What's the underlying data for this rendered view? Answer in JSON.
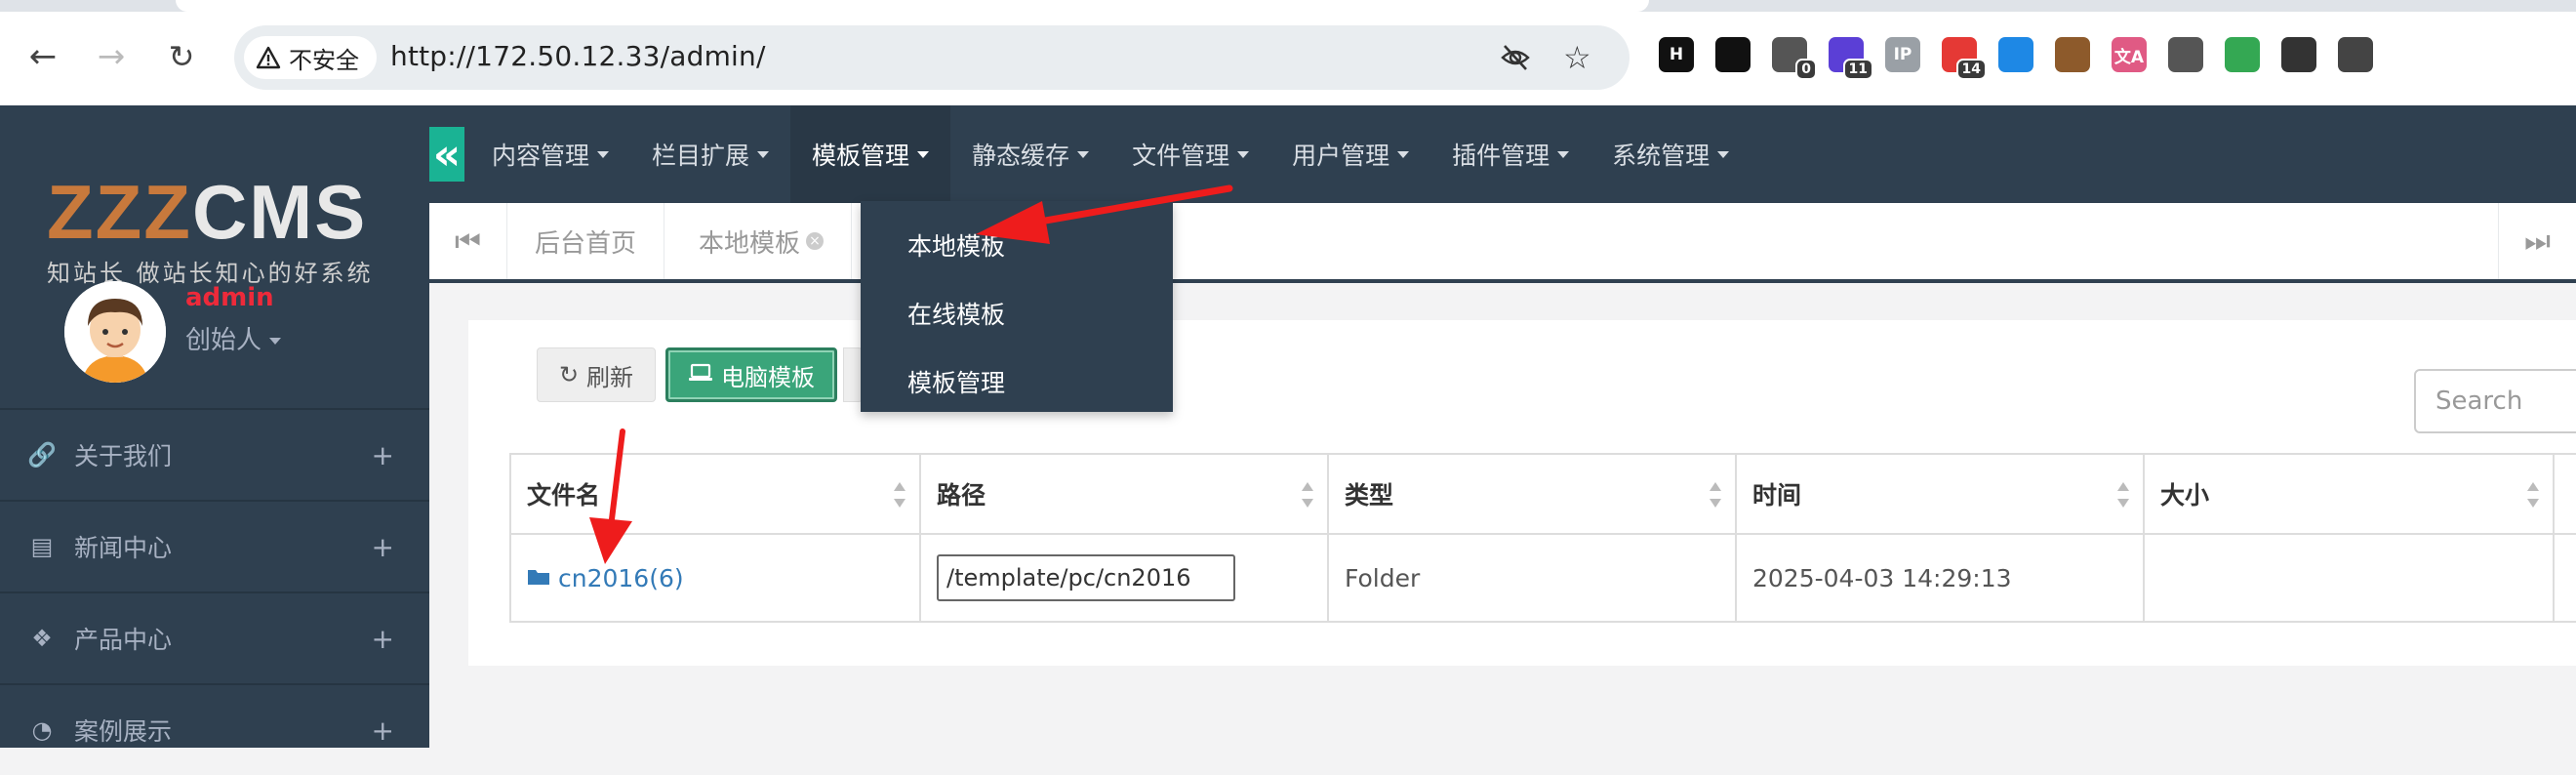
{
  "browser": {
    "security_label": "不安全",
    "url": "http://172.50.12.33/admin/",
    "extensions": [
      {
        "icon": "h-icon",
        "label": "H",
        "color": "#111111"
      },
      {
        "icon": "circle-icon",
        "label": "",
        "color": "#111111"
      },
      {
        "icon": "capture-icon",
        "label": "",
        "badge": "0",
        "color": "#555555"
      },
      {
        "icon": "stack-icon",
        "label": "",
        "badge": "11",
        "color": "#5b3fd6"
      },
      {
        "icon": "ip-icon",
        "label": "IP",
        "color": "#9aa0a6"
      },
      {
        "icon": "calendar-icon",
        "label": "",
        "badge": "14",
        "color": "#e53935"
      },
      {
        "icon": "mask-icon",
        "label": "",
        "color": "#1e88e5"
      },
      {
        "icon": "cookie-icon",
        "label": "",
        "color": "#8d5a2b"
      },
      {
        "icon": "translate-icon",
        "label": "文A",
        "color": "#e05a84"
      },
      {
        "icon": "recycle-icon",
        "label": "",
        "color": "#555555"
      },
      {
        "icon": "shield-check-icon",
        "label": "",
        "color": "#34a853"
      },
      {
        "icon": "hat-icon",
        "label": "",
        "color": "#333333"
      },
      {
        "icon": "puzzle-icon",
        "label": "",
        "color": "#444444"
      }
    ]
  },
  "sidebar": {
    "logo_main_a": "ZZZ",
    "logo_main_b": "CMS",
    "logo_slogan": "知站长 做站长知心的好系统",
    "user_name": "admin",
    "user_role": "创始人",
    "items": [
      {
        "label": "关于我们",
        "icon": "link-icon"
      },
      {
        "label": "新闻中心",
        "icon": "newspaper-icon"
      },
      {
        "label": "产品中心",
        "icon": "cubes-icon"
      },
      {
        "label": "案例展示",
        "icon": "pie-chart-icon"
      }
    ]
  },
  "topnav": {
    "items": [
      "内容管理",
      "栏目扩展",
      "模板管理",
      "静态缓存",
      "文件管理",
      "用户管理",
      "插件管理",
      "系统管理"
    ],
    "open_index": 2,
    "dropdown": [
      "本地模板",
      "在线模板",
      "模板管理"
    ]
  },
  "tabs": {
    "items": [
      "后台首页",
      "本地模板"
    ]
  },
  "toolbar": {
    "refresh_label": "刷新",
    "pc_label": "电脑模板",
    "search_placeholder": "Search"
  },
  "table": {
    "columns": [
      "文件名",
      "路径",
      "类型",
      "时间",
      "大小"
    ],
    "rows": [
      {
        "name": "cn2016(6)",
        "path": "/template/pc/cn2016",
        "type": "Folder",
        "time": "2025-04-03 14:29:13",
        "size": ""
      }
    ]
  },
  "colors": {
    "sidebar_bg": "#2f4050",
    "accent_green": "#1ab394",
    "button_green": "#3aa57a",
    "link_blue": "#337ab7",
    "user_red": "#ed2a3a",
    "annotation_red": "#ee1c1c"
  }
}
